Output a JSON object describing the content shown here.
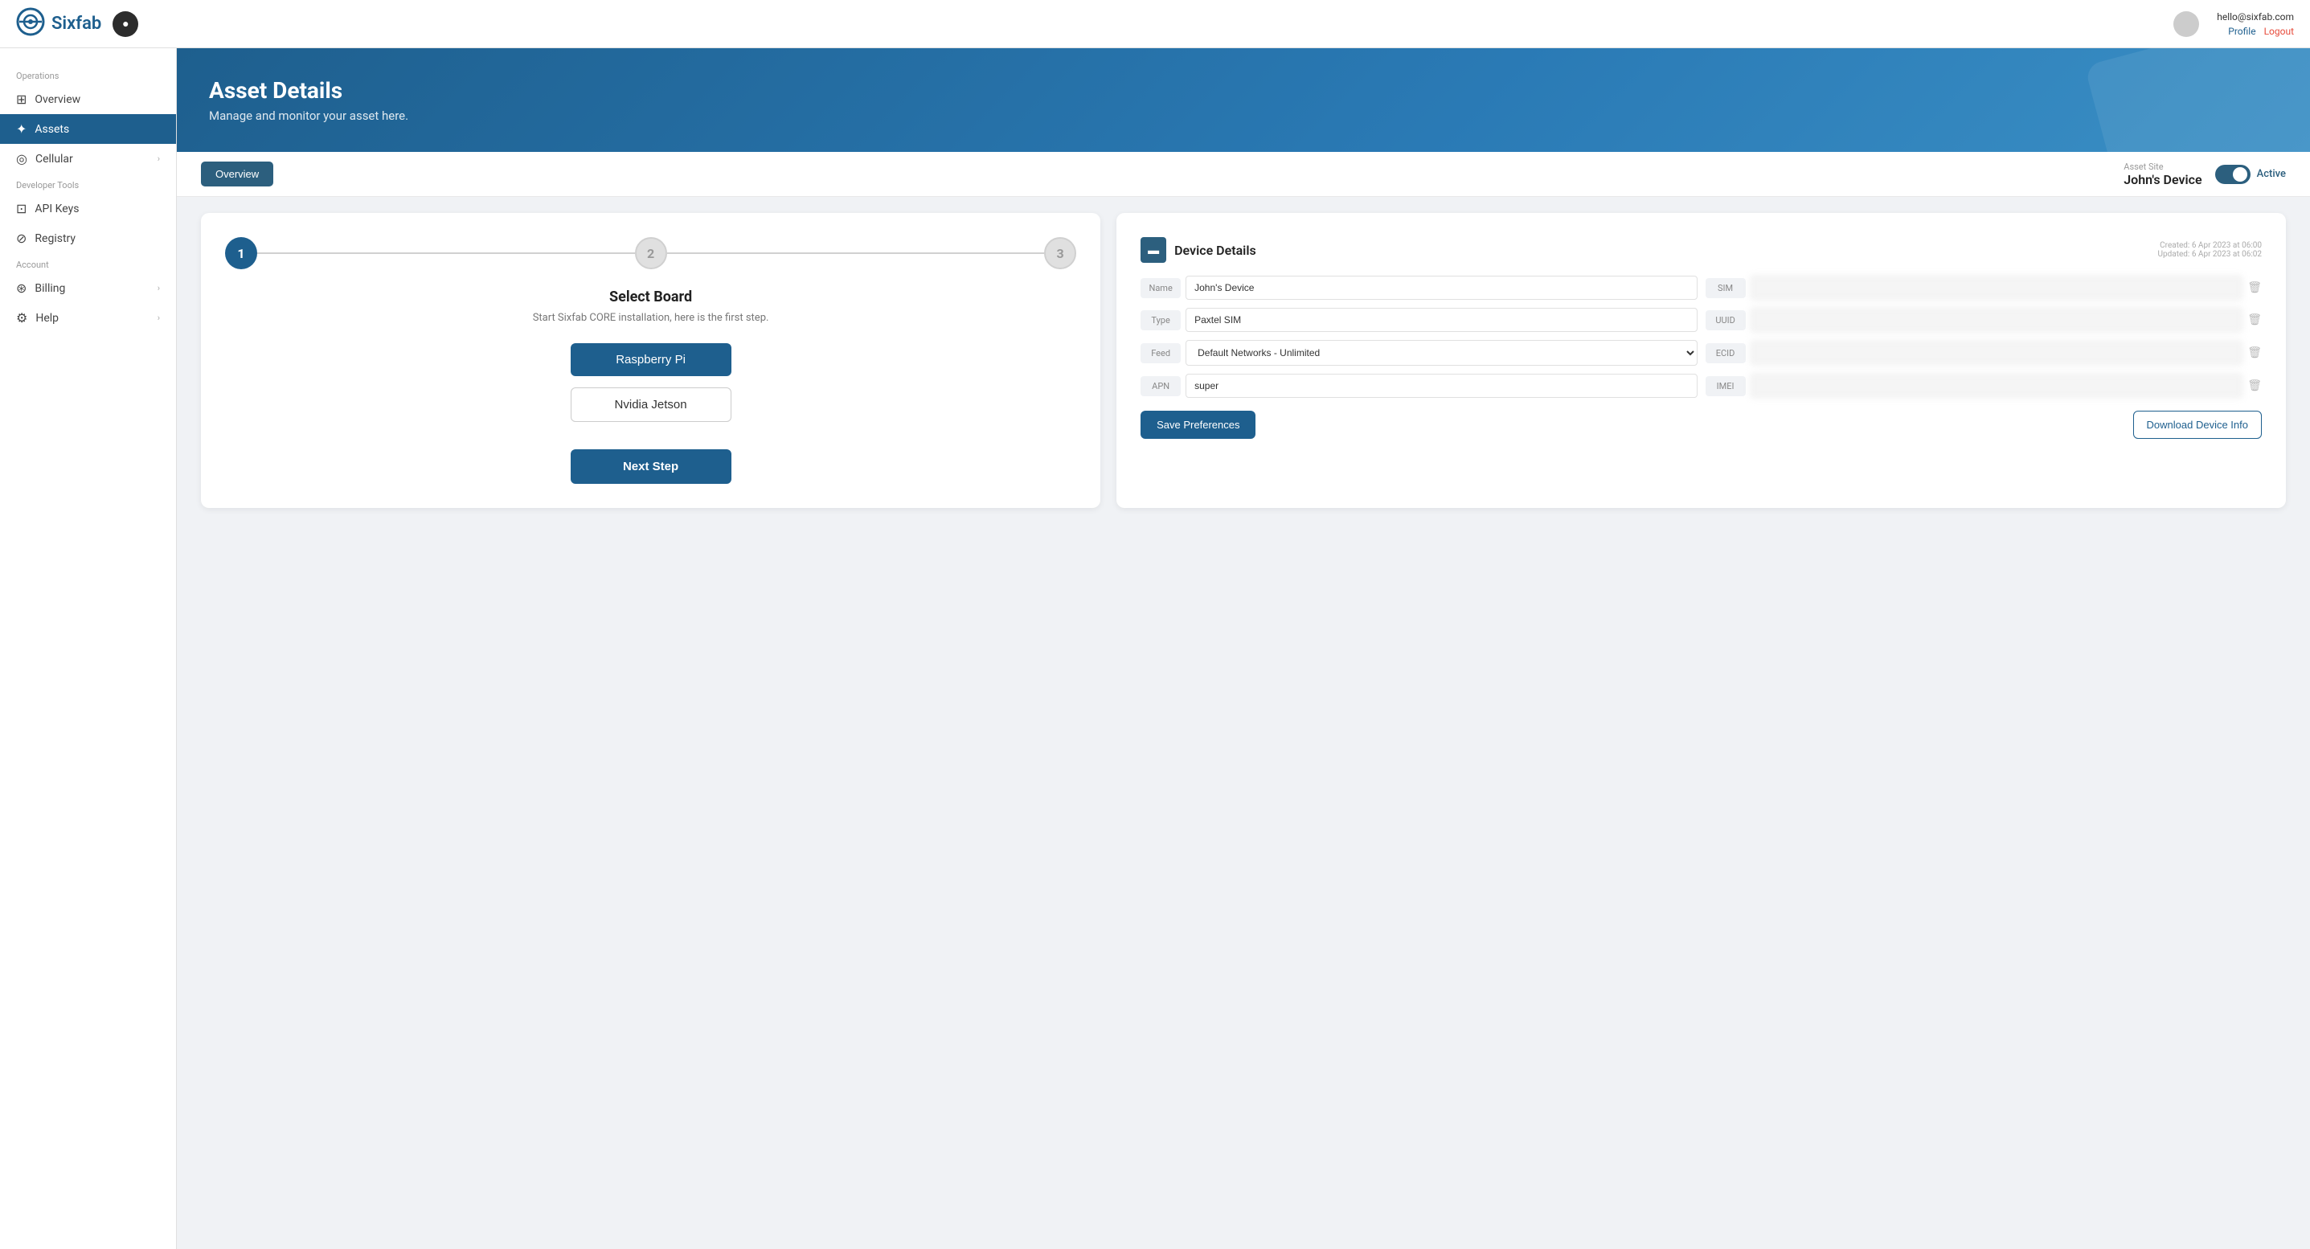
{
  "topnav": {
    "logo_text": "Sixfab",
    "user_email": "hello@sixfab.com",
    "profile_label": "Profile",
    "logout_label": "Logout",
    "nav_icon": "▼"
  },
  "sidebar": {
    "operations_label": "Operations",
    "developer_label": "Developer Tools",
    "account_label": "Account",
    "items": [
      {
        "id": "overview",
        "label": "Overview",
        "icon": "⊞",
        "active": false,
        "has_chevron": false
      },
      {
        "id": "assets",
        "label": "Assets",
        "icon": "✦",
        "active": true,
        "has_chevron": false
      },
      {
        "id": "cellular",
        "label": "Cellular",
        "icon": "◎",
        "active": false,
        "has_chevron": true
      },
      {
        "id": "api-keys",
        "label": "API Keys",
        "icon": "⊡",
        "active": false,
        "has_chevron": false
      },
      {
        "id": "registry",
        "label": "Registry",
        "icon": "⊘",
        "active": false,
        "has_chevron": false
      },
      {
        "id": "billing",
        "label": "Billing",
        "icon": "⊛",
        "active": false,
        "has_chevron": true
      },
      {
        "id": "help",
        "label": "Help",
        "icon": "⚙",
        "active": false,
        "has_chevron": true
      }
    ]
  },
  "header": {
    "title": "Asset Details",
    "subtitle": "Manage and monitor your asset here."
  },
  "tabs": {
    "overview_label": "Overview"
  },
  "asset": {
    "name_label": "Asset Site",
    "name": "John's Device",
    "status": "Active"
  },
  "select_board": {
    "step1": "1",
    "step2": "2",
    "step3": "3",
    "title": "Select Board",
    "subtitle": "Start Sixfab CORE installation, here is the first step.",
    "board_raspberry": "Raspberry Pi",
    "board_nvidia": "Nvidia Jetson",
    "next_step": "Next Step"
  },
  "device_details": {
    "title": "Device Details",
    "created": "Created: 6 Apr 2023 at 06:00",
    "updated": "Updated: 6 Apr 2023 at 06:02",
    "name_label": "Name",
    "name_value": "John's Device",
    "sim_label": "SIM",
    "type_label": "Type",
    "type_value": "Paxtel SIM",
    "uuid_label": "UUID",
    "feed_label": "Feed",
    "feed_value": "Default Networks - Unlimited",
    "ecid_label": "ECID",
    "apn_label": "APN",
    "apn_value": "super",
    "imei_label": "IMEI",
    "save_btn": "Save Preferences",
    "download_btn": "Download Device Info"
  }
}
